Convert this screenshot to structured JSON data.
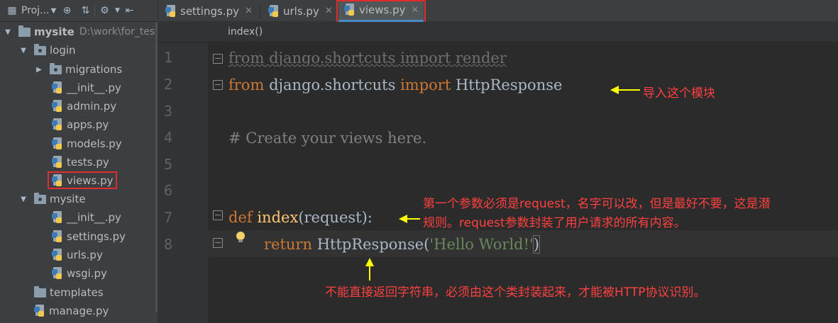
{
  "project_toolbar": {
    "label": "Proj...",
    "icons": [
      "project-view-icon",
      "dropdown-icon",
      "locate-icon",
      "collapse-icon",
      "settings-icon",
      "hide-icon"
    ]
  },
  "tree": {
    "root": {
      "name": "mysite",
      "path": "D:\\work\\for_test"
    },
    "items": [
      {
        "name": "login",
        "type": "package",
        "expanded": true
      },
      {
        "name": "migrations",
        "type": "package",
        "expanded": false
      },
      {
        "name": "__init__.py",
        "type": "python"
      },
      {
        "name": "admin.py",
        "type": "python"
      },
      {
        "name": "apps.py",
        "type": "python"
      },
      {
        "name": "models.py",
        "type": "python"
      },
      {
        "name": "tests.py",
        "type": "python"
      },
      {
        "name": "views.py",
        "type": "python",
        "highlighted": true
      },
      {
        "name": "mysite",
        "type": "package",
        "expanded": true
      },
      {
        "name": "__init__.py",
        "type": "python"
      },
      {
        "name": "settings.py",
        "type": "python"
      },
      {
        "name": "urls.py",
        "type": "python"
      },
      {
        "name": "wsgi.py",
        "type": "python"
      },
      {
        "name": "templates",
        "type": "folder"
      },
      {
        "name": "manage.py",
        "type": "python"
      }
    ]
  },
  "tabs": [
    {
      "label": "settings.py",
      "active": false
    },
    {
      "label": "urls.py",
      "active": false
    },
    {
      "label": "views.py",
      "active": true
    }
  ],
  "breadcrumb": "index()",
  "editor": {
    "line_numbers": [
      "1",
      "2",
      "3",
      "4",
      "5",
      "6",
      "7",
      "8"
    ],
    "lines": {
      "l1_from": "from",
      "l1_mod": "django.shortcuts",
      "l1_import": "import",
      "l1_name": "render",
      "l2_from": "from",
      "l2_mod": "django.shortcuts",
      "l2_import": "import",
      "l2_name": "HttpResponse",
      "l4_comment": "# Create your views here.",
      "l7_def": "def",
      "l7_fn": "index",
      "l7_args": "(request):",
      "l8_return": "return",
      "l8_call": "HttpResponse(",
      "l8_str": "'Hello World!'",
      "l8_close": ")"
    }
  },
  "annotations": {
    "import_note": "导入这个模块",
    "request_note_1": "第一个参数必须是request，名字可以改，但是最好不要，这是潜",
    "request_note_2": "规则。request参数封装了用户请求的所有内容。",
    "response_note": "不能直接返回字符串，必须由这个类封装起来，才能被HTTP协议识别。"
  },
  "colors": {
    "annotation": "#ff4040",
    "arrow": "#ffff00",
    "highlight_box": "#e02e2e",
    "keyword": "#cc7832",
    "function": "#ffc66d",
    "string": "#6a8759"
  }
}
